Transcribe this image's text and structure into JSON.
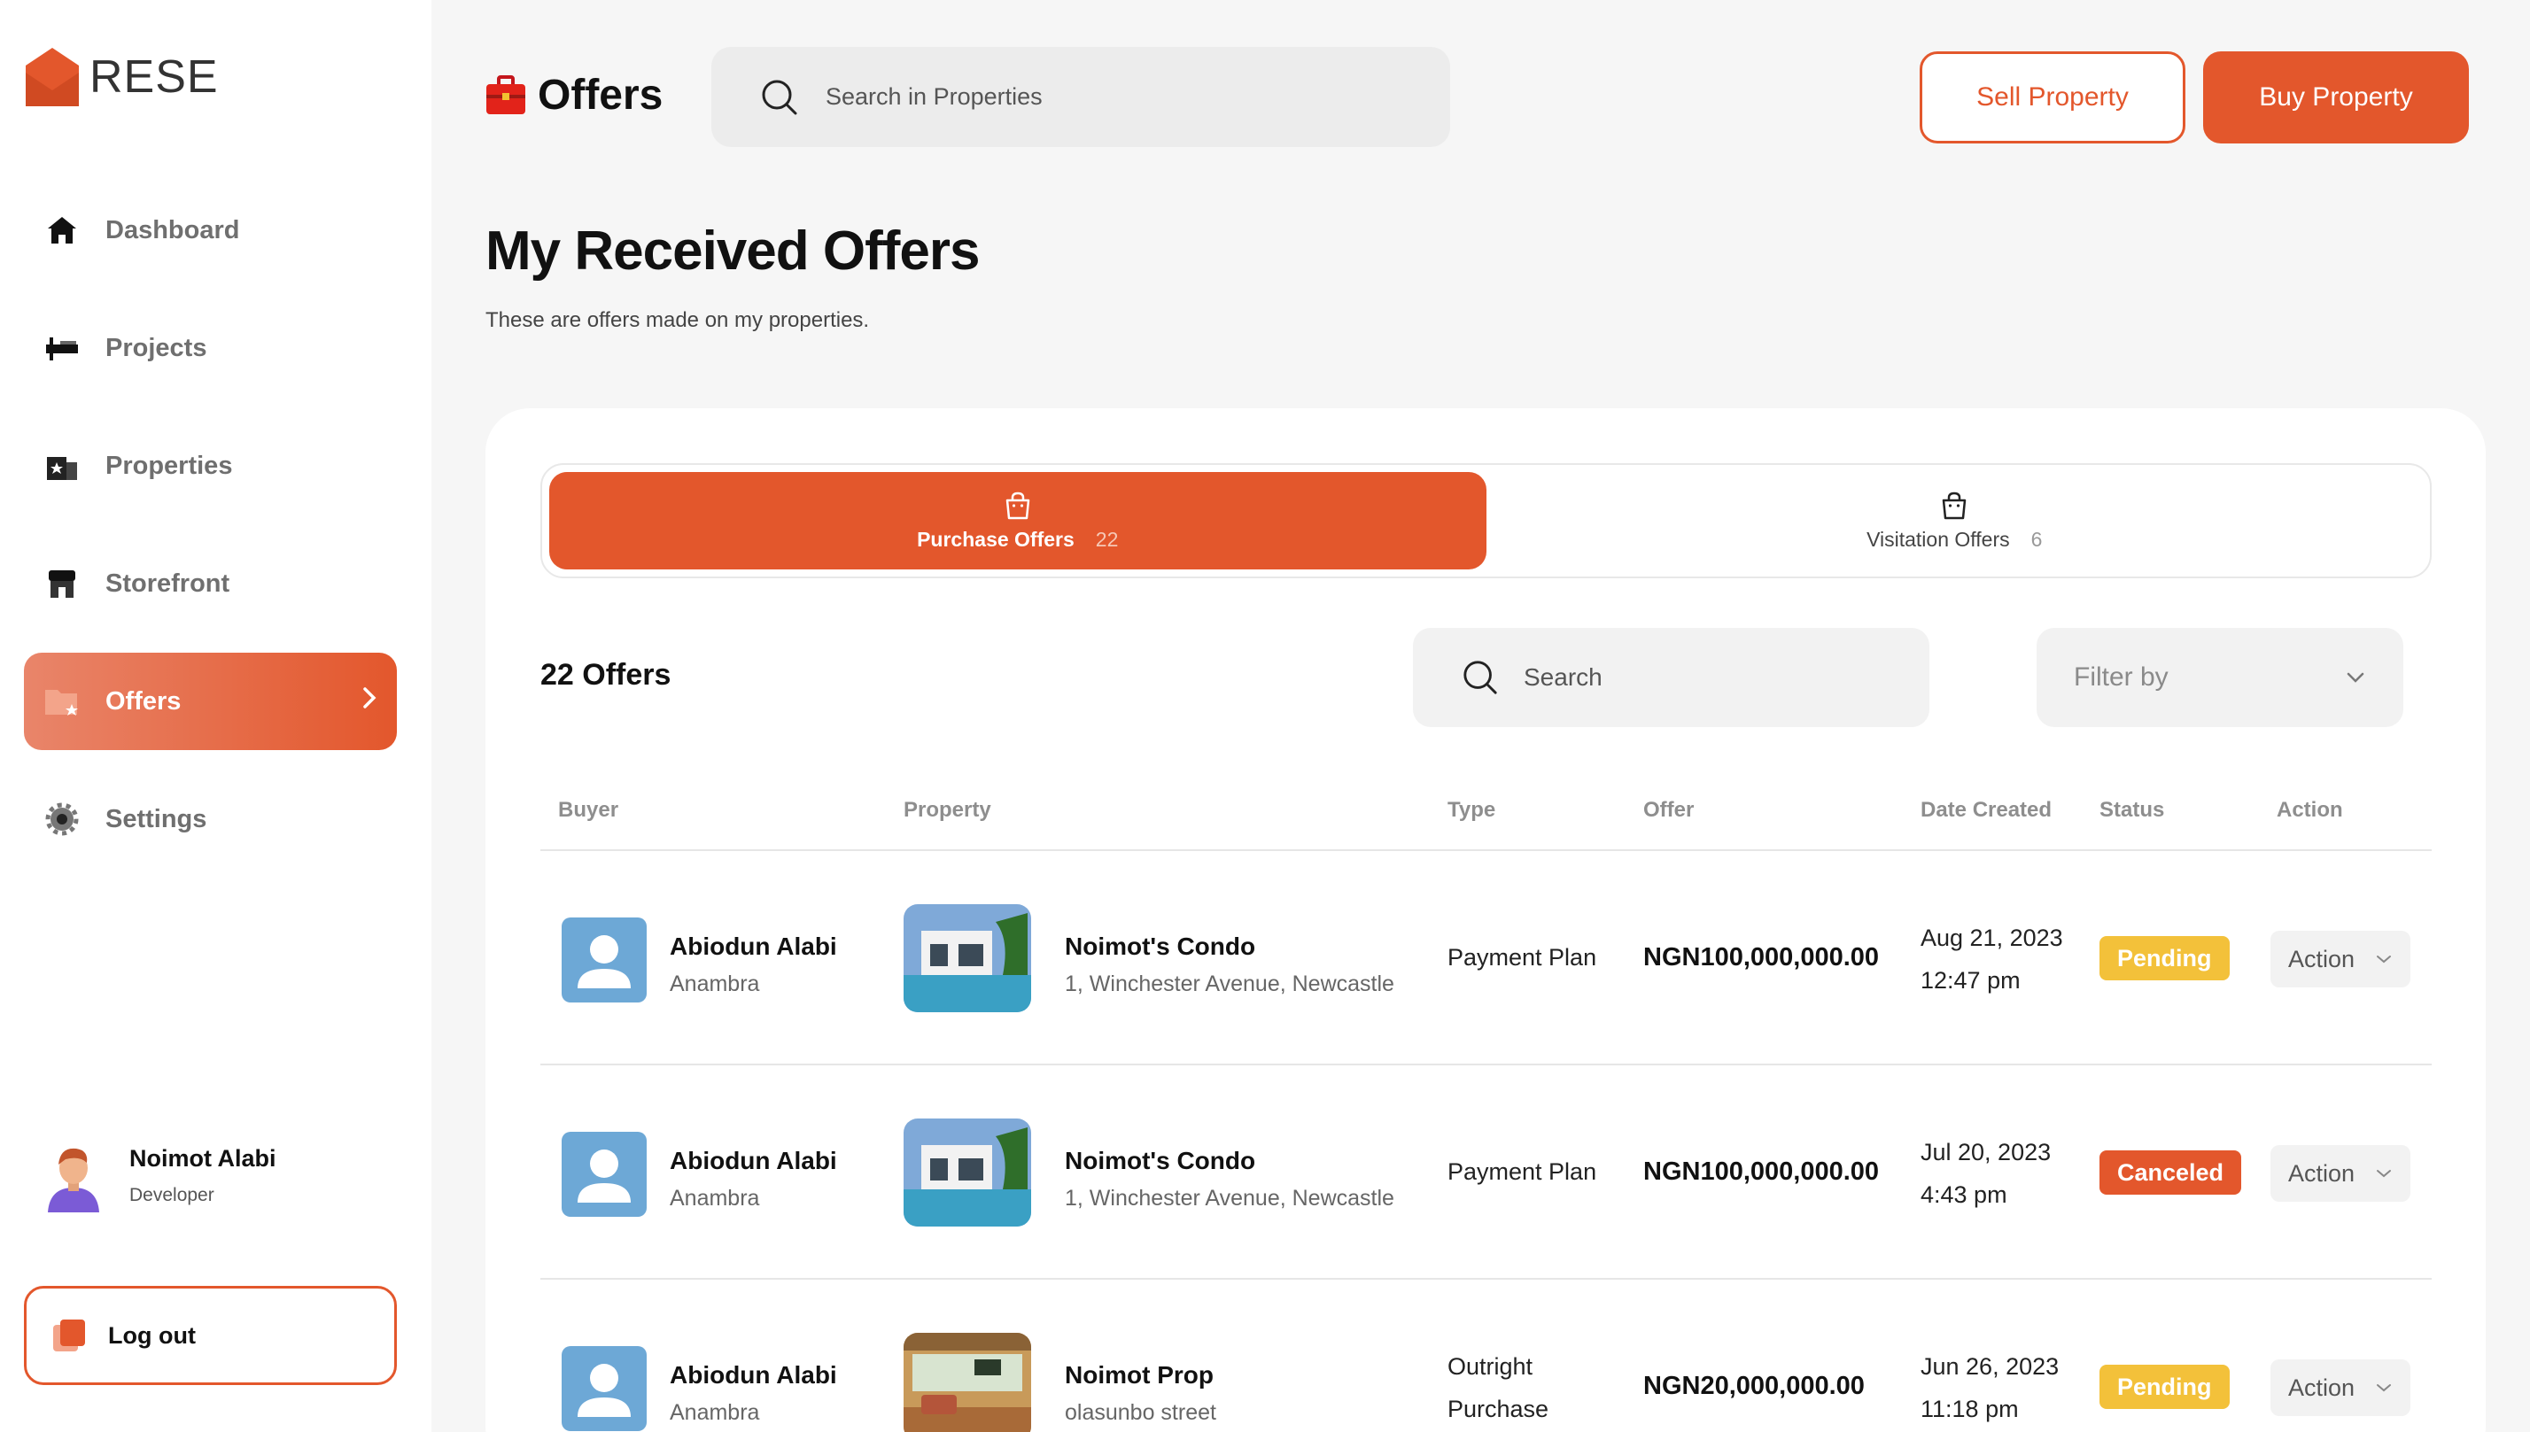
{
  "brand": {
    "name": "RESE",
    "accent": "#e3572c"
  },
  "sidebar": {
    "items": [
      {
        "label": "Dashboard",
        "icon": "home-icon"
      },
      {
        "label": "Projects",
        "icon": "projects-icon"
      },
      {
        "label": "Properties",
        "icon": "properties-icon"
      },
      {
        "label": "Storefront",
        "icon": "storefront-icon"
      },
      {
        "label": "Offers",
        "icon": "offers-icon",
        "active": true
      },
      {
        "label": "Settings",
        "icon": "gear-icon"
      }
    ],
    "user": {
      "name": "Noimot Alabi",
      "role": "Developer"
    },
    "logout_label": "Log out"
  },
  "header": {
    "title": "Offers",
    "search_placeholder": "Search in Properties",
    "sell_label": "Sell Property",
    "buy_label": "Buy Property"
  },
  "page": {
    "heading": "My Received Offers",
    "subheading": "These are offers made on my properties."
  },
  "tabs": [
    {
      "label": "Purchase Offers",
      "count": "22",
      "active": true
    },
    {
      "label": "Visitation Offers",
      "count": "6",
      "active": false
    }
  ],
  "toolbar": {
    "count_label": "22 Offers",
    "search_placeholder": "Search",
    "filter_label": "Filter by"
  },
  "table": {
    "columns": [
      "Buyer",
      "Property",
      "Type",
      "Offer",
      "Date Created",
      "Status",
      "Action"
    ],
    "rows": [
      {
        "buyer_name": "Abiodun Alabi",
        "buyer_location": "Anambra",
        "property_name": "Noimot's Condo",
        "property_address": "1, Winchester Avenue, Newcastle",
        "type_line1": "Payment Plan",
        "type_line2": "",
        "offer": "NGN100,000,000.00",
        "date": "Aug 21, 2023",
        "time": "12:47 pm",
        "status": "Pending",
        "status_kind": "pending",
        "action_label": "Action"
      },
      {
        "buyer_name": "Abiodun Alabi",
        "buyer_location": "Anambra",
        "property_name": "Noimot's Condo",
        "property_address": "1, Winchester Avenue, Newcastle",
        "type_line1": "Payment Plan",
        "type_line2": "",
        "offer": "NGN100,000,000.00",
        "date": "Jul 20, 2023",
        "time": "4:43 pm",
        "status": "Canceled",
        "status_kind": "canceled",
        "action_label": "Action"
      },
      {
        "buyer_name": "Abiodun Alabi",
        "buyer_location": "Anambra",
        "property_name": "Noimot Prop",
        "property_address": "olasunbo street",
        "type_line1": "Outright",
        "type_line2": "Purchase",
        "offer": "NGN20,000,000.00",
        "date": "Jun 26, 2023",
        "time": "11:18 pm",
        "status": "Pending",
        "status_kind": "pending",
        "action_label": "Action"
      }
    ]
  }
}
